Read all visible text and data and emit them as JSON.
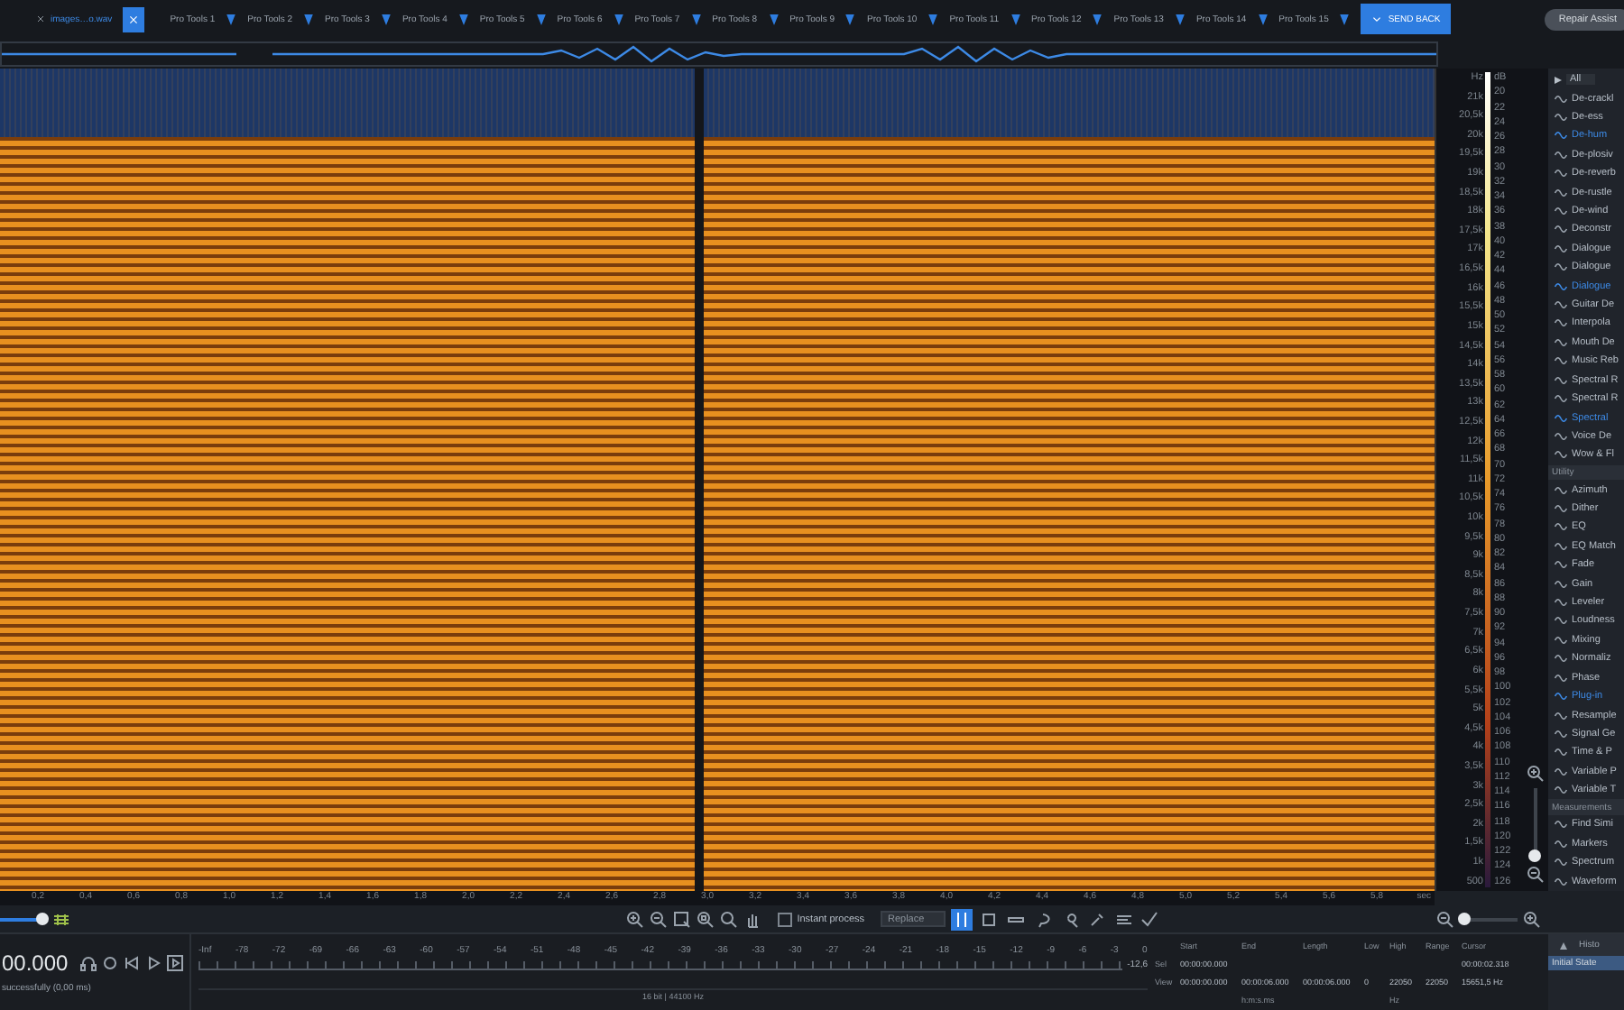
{
  "tabs": [
    {
      "kind": "file",
      "label": "images…o.wav",
      "selected": true
    },
    {
      "kind": "app",
      "label": "Pro Tools 1",
      "selected": false
    },
    {
      "kind": "app",
      "label": "Pro Tools 2",
      "selected": false
    },
    {
      "kind": "app",
      "label": "Pro Tools 3",
      "selected": false
    },
    {
      "kind": "app",
      "label": "Pro Tools 4",
      "selected": false
    },
    {
      "kind": "app",
      "label": "Pro Tools 5",
      "selected": false
    },
    {
      "kind": "app",
      "label": "Pro Tools 6",
      "selected": false
    },
    {
      "kind": "app",
      "label": "Pro Tools 7",
      "selected": false
    },
    {
      "kind": "app",
      "label": "Pro Tools 8",
      "selected": false
    },
    {
      "kind": "app",
      "label": "Pro Tools 9",
      "selected": false
    },
    {
      "kind": "app",
      "label": "Pro Tools 10",
      "selected": false
    },
    {
      "kind": "app",
      "label": "Pro Tools 11",
      "selected": false
    },
    {
      "kind": "app",
      "label": "Pro Tools 12",
      "selected": false
    },
    {
      "kind": "app",
      "label": "Pro Tools 13",
      "selected": false
    },
    {
      "kind": "app",
      "label": "Pro Tools 14",
      "selected": false
    },
    {
      "kind": "app",
      "label": "Pro Tools 15",
      "selected": false
    }
  ],
  "send_back": {
    "label": "SEND BACK"
  },
  "repair_assistant": {
    "label": "Repair Assist"
  },
  "spectrogram": {
    "hz_unit": "Hz",
    "db_unit": "dB",
    "hz_labels": [
      "21k",
      "20,5k",
      "20k",
      "19,5k",
      "19k",
      "18,5k",
      "18k",
      "17,5k",
      "17k",
      "16,5k",
      "16k",
      "15,5k",
      "15k",
      "14,5k",
      "14k",
      "13,5k",
      "13k",
      "12,5k",
      "12k",
      "11,5k",
      "11k",
      "10,5k",
      "10k",
      "9,5k",
      "9k",
      "8,5k",
      "8k",
      "7,5k",
      "7k",
      "6,5k",
      "6k",
      "5,5k",
      "5k",
      "4,5k",
      "4k",
      "3,5k",
      "3k",
      "2,5k",
      "2k",
      "1,5k",
      "1k",
      "500"
    ],
    "db_labels": [
      "20",
      "22",
      "24",
      "26",
      "28",
      "30",
      "32",
      "34",
      "36",
      "38",
      "40",
      "42",
      "44",
      "46",
      "48",
      "50",
      "52",
      "54",
      "56",
      "58",
      "60",
      "62",
      "64",
      "66",
      "68",
      "70",
      "72",
      "74",
      "76",
      "78",
      "80",
      "82",
      "84",
      "86",
      "88",
      "90",
      "92",
      "94",
      "96",
      "98",
      "100",
      "102",
      "104",
      "106",
      "108",
      "110",
      "112",
      "114",
      "116",
      "118",
      "120",
      "122",
      "124",
      "126"
    ],
    "time_labels": [
      "0,2",
      "0,4",
      "0,6",
      "0,8",
      "1,0",
      "1,2",
      "1,4",
      "1,6",
      "1,8",
      "2,0",
      "2,2",
      "2,4",
      "2,6",
      "2,8",
      "3,0",
      "3,2",
      "3,4",
      "3,6",
      "3,8",
      "4,0",
      "4,2",
      "4,4",
      "4,6",
      "4,8",
      "5,0",
      "5,2",
      "5,4",
      "5,6",
      "5,8",
      "sec"
    ]
  },
  "modules": [
    {
      "kind": "filter",
      "label": "All",
      "selected": false
    },
    {
      "kind": "item",
      "label": "De-crackl",
      "selected": false
    },
    {
      "kind": "item",
      "label": "De-ess",
      "selected": false
    },
    {
      "kind": "item",
      "label": "De-hum",
      "selected": true
    },
    {
      "kind": "item",
      "label": "De-plosiv",
      "selected": false
    },
    {
      "kind": "item",
      "label": "De-reverb",
      "selected": false
    },
    {
      "kind": "item",
      "label": "De-rustle",
      "selected": false
    },
    {
      "kind": "item",
      "label": "De-wind",
      "selected": false
    },
    {
      "kind": "item",
      "label": "Deconstr",
      "selected": false
    },
    {
      "kind": "item",
      "label": "Dialogue",
      "selected": false
    },
    {
      "kind": "item",
      "label": "Dialogue",
      "selected": false
    },
    {
      "kind": "item",
      "label": "Dialogue",
      "selected": true
    },
    {
      "kind": "item",
      "label": "Guitar De",
      "selected": false
    },
    {
      "kind": "item",
      "label": "Interpola",
      "selected": false
    },
    {
      "kind": "item",
      "label": "Mouth De",
      "selected": false
    },
    {
      "kind": "item",
      "label": "Music Reb",
      "selected": false
    },
    {
      "kind": "item",
      "label": "Spectral R",
      "selected": false
    },
    {
      "kind": "item",
      "label": "Spectral R",
      "selected": false
    },
    {
      "kind": "item",
      "label": "Spectral",
      "selected": true
    },
    {
      "kind": "item",
      "label": "Voice De",
      "selected": false
    },
    {
      "kind": "item",
      "label": "Wow & Fl",
      "selected": false
    },
    {
      "kind": "header",
      "label": "Utility"
    },
    {
      "kind": "item",
      "label": "Azimuth",
      "selected": false
    },
    {
      "kind": "item",
      "label": "Dither",
      "selected": false
    },
    {
      "kind": "item",
      "label": "EQ",
      "selected": false
    },
    {
      "kind": "item",
      "label": "EQ Match",
      "selected": false
    },
    {
      "kind": "item",
      "label": "Fade",
      "selected": false
    },
    {
      "kind": "item",
      "label": "Gain",
      "selected": false
    },
    {
      "kind": "item",
      "label": "Leveler",
      "selected": false
    },
    {
      "kind": "item",
      "label": "Loudness",
      "selected": false
    },
    {
      "kind": "item",
      "label": "Mixing",
      "selected": false
    },
    {
      "kind": "item",
      "label": "Normaliz",
      "selected": false
    },
    {
      "kind": "item",
      "label": "Phase",
      "selected": false
    },
    {
      "kind": "item",
      "label": "Plug-in",
      "selected": true
    },
    {
      "kind": "item",
      "label": "Resample",
      "selected": false
    },
    {
      "kind": "item",
      "label": "Signal Ge",
      "selected": false
    },
    {
      "kind": "item",
      "label": "Time & P",
      "selected": false
    },
    {
      "kind": "item",
      "label": "Variable P",
      "selected": false
    },
    {
      "kind": "item",
      "label": "Variable T",
      "selected": false
    },
    {
      "kind": "header",
      "label": "Measurements"
    },
    {
      "kind": "item",
      "label": "Find Simi",
      "selected": false
    },
    {
      "kind": "item",
      "label": "Markers",
      "selected": false
    },
    {
      "kind": "item",
      "label": "Spectrum",
      "selected": false
    },
    {
      "kind": "item",
      "label": "Waveform",
      "selected": false
    }
  ],
  "zoom_slider": {
    "level": 0.9
  },
  "toolbar": {
    "instant_process": {
      "label": "Instant process",
      "checked": false
    },
    "mode": {
      "value": "Replace"
    },
    "tools": [
      {
        "selected": true
      },
      {
        "selected": false
      },
      {
        "selected": false
      },
      {
        "selected": false
      },
      {
        "selected": false
      },
      {
        "selected": false
      },
      {
        "selected": false
      }
    ]
  },
  "transport": {
    "time": "00.000",
    "status": "successfully (0,00 ms)"
  },
  "meter": {
    "labels": [
      "-Inf",
      "-78",
      "-72",
      "-69",
      "-66",
      "-63",
      "-60",
      "-57",
      "-54",
      "-51",
      "-48",
      "-45",
      "-42",
      "-39",
      "-36",
      "-33",
      "-30",
      "-27",
      "-24",
      "-21",
      "-18",
      "-15",
      "-12",
      "-9",
      "-6",
      "-3",
      "0"
    ],
    "peak": "-12,6",
    "format": "16 bit | 44100 Hz"
  },
  "selection": {
    "columns": [
      "Start",
      "End",
      "Length",
      "Low",
      "High",
      "Range",
      "Cursor"
    ],
    "rows": [
      {
        "label": "Sel",
        "cells": [
          "00:00:00.000",
          "",
          "",
          "",
          "",
          "",
          ""
        ]
      },
      {
        "label": "View",
        "cells": [
          "00:00:00.000",
          "00:00:06.000",
          "00:00:06.000",
          "0",
          "22050",
          "22050",
          ""
        ]
      }
    ],
    "cursor": [
      "00:00:02.318",
      "15651,5 Hz"
    ],
    "time_unit": "h:m:s.ms",
    "freq_unit": "Hz"
  },
  "h_zoom": {
    "level": 0.05
  },
  "v_zoom": {
    "level": 0.05
  },
  "history": {
    "title": "Histo",
    "items": [
      {
        "label": "Initial State",
        "selected": true
      }
    ]
  }
}
